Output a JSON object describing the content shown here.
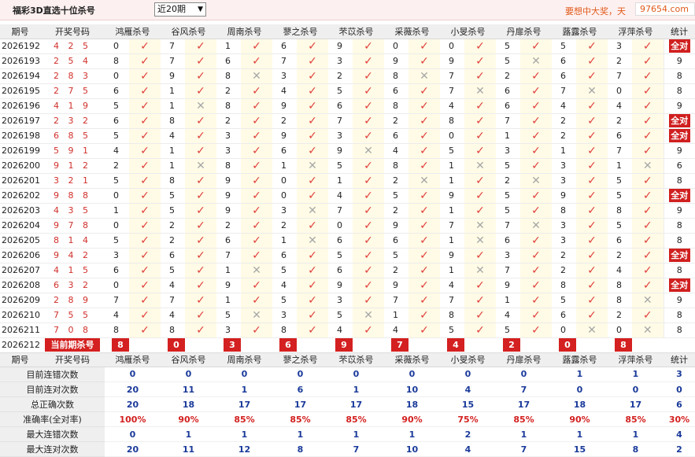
{
  "header": {
    "title": "福彩3D直选十位杀号",
    "period_select": "近20期",
    "promo": "要想中大奖，天",
    "watermark": "97654.com"
  },
  "columns": {
    "issue": "期号",
    "draw": "开奖号码",
    "killers": [
      "鸿雁杀号",
      "谷风杀号",
      "周南杀号",
      "蓼之杀号",
      "芣苡杀号",
      "采薇杀号",
      "小旻杀号",
      "丹扉杀号",
      "蕗露杀号",
      "浮萍杀号"
    ],
    "stat": "统计"
  },
  "rows": [
    {
      "issue": "2026192",
      "draw": "4 2 5",
      "nums": [
        0,
        7,
        1,
        6,
        9,
        0,
        0,
        5,
        5,
        3
      ],
      "marks": [
        1,
        1,
        1,
        1,
        1,
        1,
        1,
        1,
        1,
        1
      ],
      "stat": "全对"
    },
    {
      "issue": "2026193",
      "draw": "2 5 4",
      "nums": [
        8,
        7,
        6,
        7,
        3,
        9,
        9,
        5,
        6,
        2
      ],
      "marks": [
        1,
        1,
        1,
        1,
        1,
        1,
        1,
        0,
        1,
        1
      ],
      "stat": "9"
    },
    {
      "issue": "2026194",
      "draw": "2 8 3",
      "nums": [
        0,
        9,
        8,
        3,
        2,
        8,
        7,
        2,
        6,
        7
      ],
      "marks": [
        1,
        1,
        0,
        1,
        1,
        0,
        1,
        1,
        1,
        1
      ],
      "stat": "8"
    },
    {
      "issue": "2026195",
      "draw": "2 7 5",
      "nums": [
        6,
        1,
        2,
        4,
        5,
        6,
        7,
        6,
        7,
        0
      ],
      "marks": [
        1,
        1,
        1,
        1,
        1,
        1,
        0,
        1,
        0,
        1
      ],
      "stat": "8"
    },
    {
      "issue": "2026196",
      "draw": "4 1 9",
      "nums": [
        5,
        1,
        8,
        9,
        6,
        8,
        4,
        6,
        4,
        4
      ],
      "marks": [
        1,
        0,
        1,
        1,
        1,
        1,
        1,
        1,
        1,
        1
      ],
      "stat": "9"
    },
    {
      "issue": "2026197",
      "draw": "2 3 2",
      "nums": [
        6,
        8,
        2,
        2,
        7,
        2,
        8,
        7,
        2,
        2
      ],
      "marks": [
        1,
        1,
        1,
        1,
        1,
        1,
        1,
        1,
        1,
        1
      ],
      "stat": "全对"
    },
    {
      "issue": "2026198",
      "draw": "6 8 5",
      "nums": [
        5,
        4,
        3,
        9,
        3,
        6,
        0,
        1,
        2,
        6
      ],
      "marks": [
        1,
        1,
        1,
        1,
        1,
        1,
        1,
        1,
        1,
        1
      ],
      "stat": "全对"
    },
    {
      "issue": "2026199",
      "draw": "5 9 1",
      "nums": [
        4,
        1,
        3,
        6,
        9,
        4,
        5,
        3,
        1,
        7
      ],
      "marks": [
        1,
        1,
        1,
        1,
        0,
        1,
        1,
        1,
        1,
        1
      ],
      "stat": "9"
    },
    {
      "issue": "2026200",
      "draw": "9 1 2",
      "nums": [
        2,
        1,
        8,
        1,
        5,
        8,
        1,
        5,
        3,
        1
      ],
      "marks": [
        1,
        0,
        1,
        0,
        1,
        1,
        0,
        1,
        1,
        0
      ],
      "stat": "6"
    },
    {
      "issue": "2026201",
      "draw": "3 2 1",
      "nums": [
        5,
        8,
        9,
        0,
        1,
        2,
        1,
        2,
        3,
        5
      ],
      "marks": [
        1,
        1,
        1,
        1,
        1,
        0,
        1,
        0,
        1,
        1
      ],
      "stat": "8"
    },
    {
      "issue": "2026202",
      "draw": "9 8 8",
      "nums": [
        0,
        5,
        9,
        0,
        4,
        5,
        9,
        5,
        9,
        5
      ],
      "marks": [
        1,
        1,
        1,
        1,
        1,
        1,
        1,
        1,
        1,
        1
      ],
      "stat": "全对"
    },
    {
      "issue": "2026203",
      "draw": "4 3 5",
      "nums": [
        1,
        5,
        9,
        3,
        7,
        2,
        1,
        5,
        8,
        8
      ],
      "marks": [
        1,
        1,
        1,
        0,
        1,
        1,
        1,
        1,
        1,
        1
      ],
      "stat": "9"
    },
    {
      "issue": "2026204",
      "draw": "9 7 8",
      "nums": [
        0,
        2,
        2,
        2,
        0,
        9,
        7,
        7,
        3,
        5
      ],
      "marks": [
        1,
        1,
        1,
        1,
        1,
        1,
        0,
        0,
        1,
        1
      ],
      "stat": "8"
    },
    {
      "issue": "2026205",
      "draw": "8 1 4",
      "nums": [
        5,
        2,
        6,
        1,
        6,
        6,
        1,
        6,
        3,
        6
      ],
      "marks": [
        1,
        1,
        1,
        0,
        1,
        1,
        0,
        1,
        1,
        1
      ],
      "stat": "8"
    },
    {
      "issue": "2026206",
      "draw": "9 4 2",
      "nums": [
        3,
        6,
        7,
        6,
        5,
        5,
        9,
        3,
        2,
        2
      ],
      "marks": [
        1,
        1,
        1,
        1,
        1,
        1,
        1,
        1,
        1,
        1
      ],
      "stat": "全对"
    },
    {
      "issue": "2026207",
      "draw": "4 1 5",
      "nums": [
        6,
        5,
        1,
        5,
        6,
        2,
        1,
        7,
        2,
        4
      ],
      "marks": [
        1,
        1,
        0,
        1,
        1,
        1,
        0,
        1,
        1,
        1
      ],
      "stat": "8"
    },
    {
      "issue": "2026208",
      "draw": "6 3 2",
      "nums": [
        0,
        4,
        9,
        4,
        9,
        9,
        4,
        9,
        8,
        8
      ],
      "marks": [
        1,
        1,
        1,
        1,
        1,
        1,
        1,
        1,
        1,
        1
      ],
      "stat": "全对"
    },
    {
      "issue": "2026209",
      "draw": "2 8 9",
      "nums": [
        7,
        7,
        1,
        5,
        3,
        7,
        7,
        1,
        5,
        8
      ],
      "marks": [
        1,
        1,
        1,
        1,
        1,
        1,
        1,
        1,
        1,
        0
      ],
      "stat": "9"
    },
    {
      "issue": "2026210",
      "draw": "7 5 5",
      "nums": [
        4,
        4,
        5,
        3,
        5,
        1,
        8,
        4,
        6,
        2
      ],
      "marks": [
        1,
        1,
        0,
        1,
        0,
        1,
        1,
        1,
        1,
        1
      ],
      "stat": "8"
    },
    {
      "issue": "2026211",
      "draw": "7 0 8",
      "nums": [
        8,
        8,
        3,
        8,
        4,
        4,
        5,
        5,
        0,
        0
      ],
      "marks": [
        1,
        1,
        1,
        1,
        1,
        1,
        1,
        1,
        0,
        0
      ],
      "stat": "8"
    }
  ],
  "current": {
    "issue": "2026212",
    "label": "当前期杀号",
    "nums": [
      "8",
      "0",
      "3",
      "6",
      "9",
      "7",
      "4",
      "2",
      "0",
      "8"
    ]
  },
  "summary": [
    {
      "label": "目前连错次数",
      "values": [
        "0",
        "0",
        "0",
        "0",
        "0",
        "0",
        "0",
        "0",
        "1",
        "1"
      ],
      "stat": "3",
      "red": false
    },
    {
      "label": "目前连对次数",
      "values": [
        "20",
        "11",
        "1",
        "6",
        "1",
        "10",
        "4",
        "7",
        "0",
        "0"
      ],
      "stat": "0",
      "red": false
    },
    {
      "label": "总正确次数",
      "values": [
        "20",
        "18",
        "17",
        "17",
        "17",
        "18",
        "15",
        "17",
        "18",
        "17"
      ],
      "stat": "6",
      "red": false
    },
    {
      "label": "准确率(全对率)",
      "values": [
        "100%",
        "90%",
        "85%",
        "85%",
        "85%",
        "90%",
        "75%",
        "85%",
        "90%",
        "85%"
      ],
      "stat": "30%",
      "red": true
    },
    {
      "label": "最大连错次数",
      "values": [
        "0",
        "1",
        "1",
        "1",
        "1",
        "1",
        "2",
        "1",
        "1",
        "1"
      ],
      "stat": "4",
      "red": false
    },
    {
      "label": "最大连对次数",
      "values": [
        "20",
        "11",
        "12",
        "8",
        "7",
        "10",
        "4",
        "7",
        "15",
        "8"
      ],
      "stat": "2",
      "red": false
    }
  ],
  "icons": {
    "correct": "check-icon",
    "wrong": "cross-icon"
  },
  "colors": {
    "accent_red": "#d42020",
    "value_blue": "#1a3a9a",
    "mark_bg": "#fffbe6"
  }
}
